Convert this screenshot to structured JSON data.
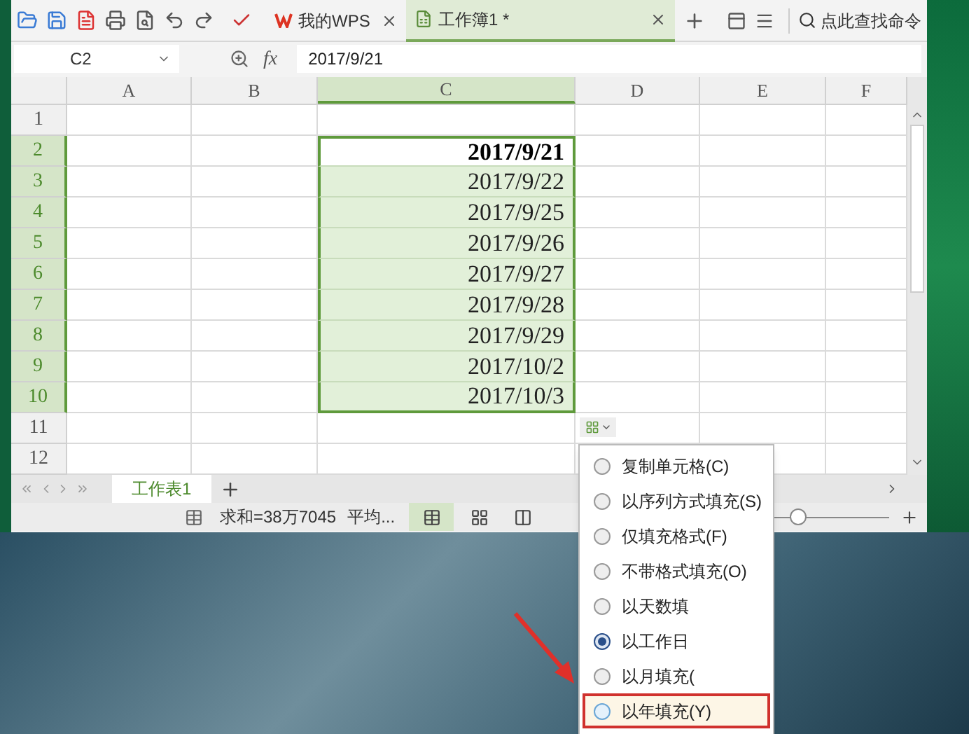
{
  "toolbar": {
    "tabs": [
      {
        "kind": "home",
        "label": "我的WPS",
        "selected": false
      },
      {
        "kind": "doc",
        "label": "工作簿1 *",
        "selected": true
      }
    ],
    "search": {
      "placeholder": "点此查找命令"
    }
  },
  "formula_bar": {
    "name_box": "C2",
    "fx": "fx",
    "value": "2017/9/21"
  },
  "columns": [
    {
      "label": "A",
      "selected": false
    },
    {
      "label": "B",
      "selected": false
    },
    {
      "label": "C",
      "selected": true
    },
    {
      "label": "D",
      "selected": false
    },
    {
      "label": "E",
      "selected": false
    },
    {
      "label": "F",
      "selected": false
    }
  ],
  "rows": [
    {
      "number": "1",
      "selected": false,
      "active": false,
      "value": ""
    },
    {
      "number": "2",
      "selected": true,
      "active": true,
      "value": "2017/9/21"
    },
    {
      "number": "3",
      "selected": true,
      "active": false,
      "value": "2017/9/22"
    },
    {
      "number": "4",
      "selected": true,
      "active": false,
      "value": "2017/9/25"
    },
    {
      "number": "5",
      "selected": true,
      "active": false,
      "value": "2017/9/26"
    },
    {
      "number": "6",
      "selected": true,
      "active": false,
      "value": "2017/9/27"
    },
    {
      "number": "7",
      "selected": true,
      "active": false,
      "value": "2017/9/28"
    },
    {
      "number": "8",
      "selected": true,
      "active": false,
      "value": "2017/9/29"
    },
    {
      "number": "9",
      "selected": true,
      "active": false,
      "value": "2017/10/2"
    },
    {
      "number": "10",
      "selected": true,
      "active": false,
      "value": "2017/10/3"
    },
    {
      "number": "11",
      "selected": false,
      "active": false,
      "value": ""
    },
    {
      "number": "12",
      "selected": false,
      "active": false,
      "value": ""
    }
  ],
  "sheet_tabs": [
    {
      "label": "工作表1",
      "selected": true
    }
  ],
  "status_bar": {
    "sum": "求和=38万7045",
    "average": "平均...",
    "zoom": {
      "level": 0.45
    }
  },
  "fill_menu": [
    {
      "label": "复制单元格(C)",
      "selected": false,
      "annotated": false
    },
    {
      "label": "以序列方式填充(S)",
      "selected": false,
      "annotated": false
    },
    {
      "label": "仅填充格式(F)",
      "selected": false,
      "annotated": false
    },
    {
      "label": "不带格式填充(O)",
      "selected": false,
      "annotated": false
    },
    {
      "label": "以天数填",
      "selected": false,
      "annotated": false
    },
    {
      "label": "以工作日",
      "selected": true,
      "annotated": false
    },
    {
      "label": "以月填充(",
      "selected": false,
      "annotated": false
    },
    {
      "label": "以年填充(Y)",
      "selected": false,
      "annotated": true
    }
  ]
}
